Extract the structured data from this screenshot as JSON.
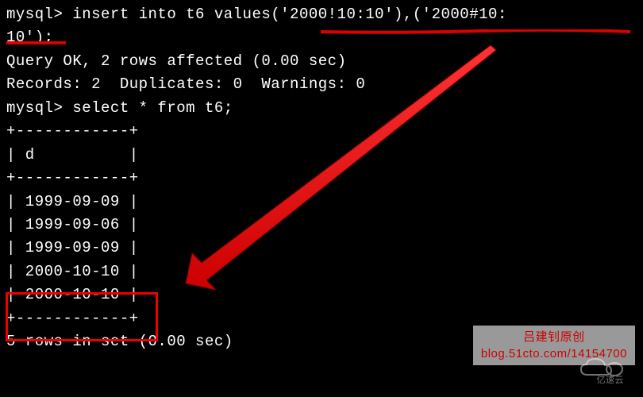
{
  "terminal": {
    "prompt": "mysql>",
    "insert_line1": "mysql> insert into t6 values('2000!10:10'),('2000#10:",
    "insert_line2": "10');",
    "query_ok": "Query OK, 2 rows affected (0.00 sec)",
    "records": "Records: 2  Duplicates: 0  Warnings: 0",
    "blank": "",
    "select_stmt": "mysql> select * from t6;",
    "border": "+------------+",
    "header": "| d          |",
    "rows": [
      "| 1999-09-09 |",
      "| 1999-09-06 |",
      "| 1999-09-09 |",
      "| 2000-10-10 |",
      "| 2000-10-10 |"
    ],
    "result": "5 rows in set (0.00 sec)"
  },
  "chart_data": {
    "type": "table",
    "title": "t6",
    "columns": [
      "d"
    ],
    "rows": [
      [
        "1999-09-09"
      ],
      [
        "1999-09-06"
      ],
      [
        "1999-09-09"
      ],
      [
        "2000-10-10"
      ],
      [
        "2000-10-10"
      ]
    ]
  },
  "watermark": {
    "title": "吕建钊原创",
    "url": "blog.51cto.com/14154700",
    "brand": "亿速云"
  }
}
